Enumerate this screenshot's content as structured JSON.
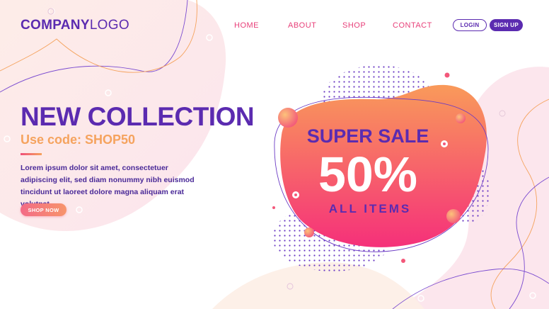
{
  "logo": {
    "bold": "COMPANY",
    "light": "LOGO"
  },
  "nav": {
    "items": [
      "HOME",
      "ABOUT",
      "SHOP",
      "CONTACT"
    ],
    "login": "LOGIN",
    "signup": "SIGN UP"
  },
  "hero": {
    "title": "NEW COLLECTION",
    "code_text": "Use code: SHOP50",
    "body": "Lorem ipsum dolor sit amet, consectetuer adipiscing elit, sed diam nonummy nibh euismod tincidunt ut laoreet dolore magna aliquam erat volutpat.",
    "cta": "SHOP NOW"
  },
  "sale": {
    "headline": "SUPER SALE",
    "percent": "50%",
    "subline": "ALL ITEMS"
  },
  "colors": {
    "primary": "#5b2bb0",
    "accent_pink": "#e8407a",
    "accent_orange": "#f5a35e",
    "blob_top": "#f99a5a",
    "blob_bottom": "#f5307a"
  }
}
